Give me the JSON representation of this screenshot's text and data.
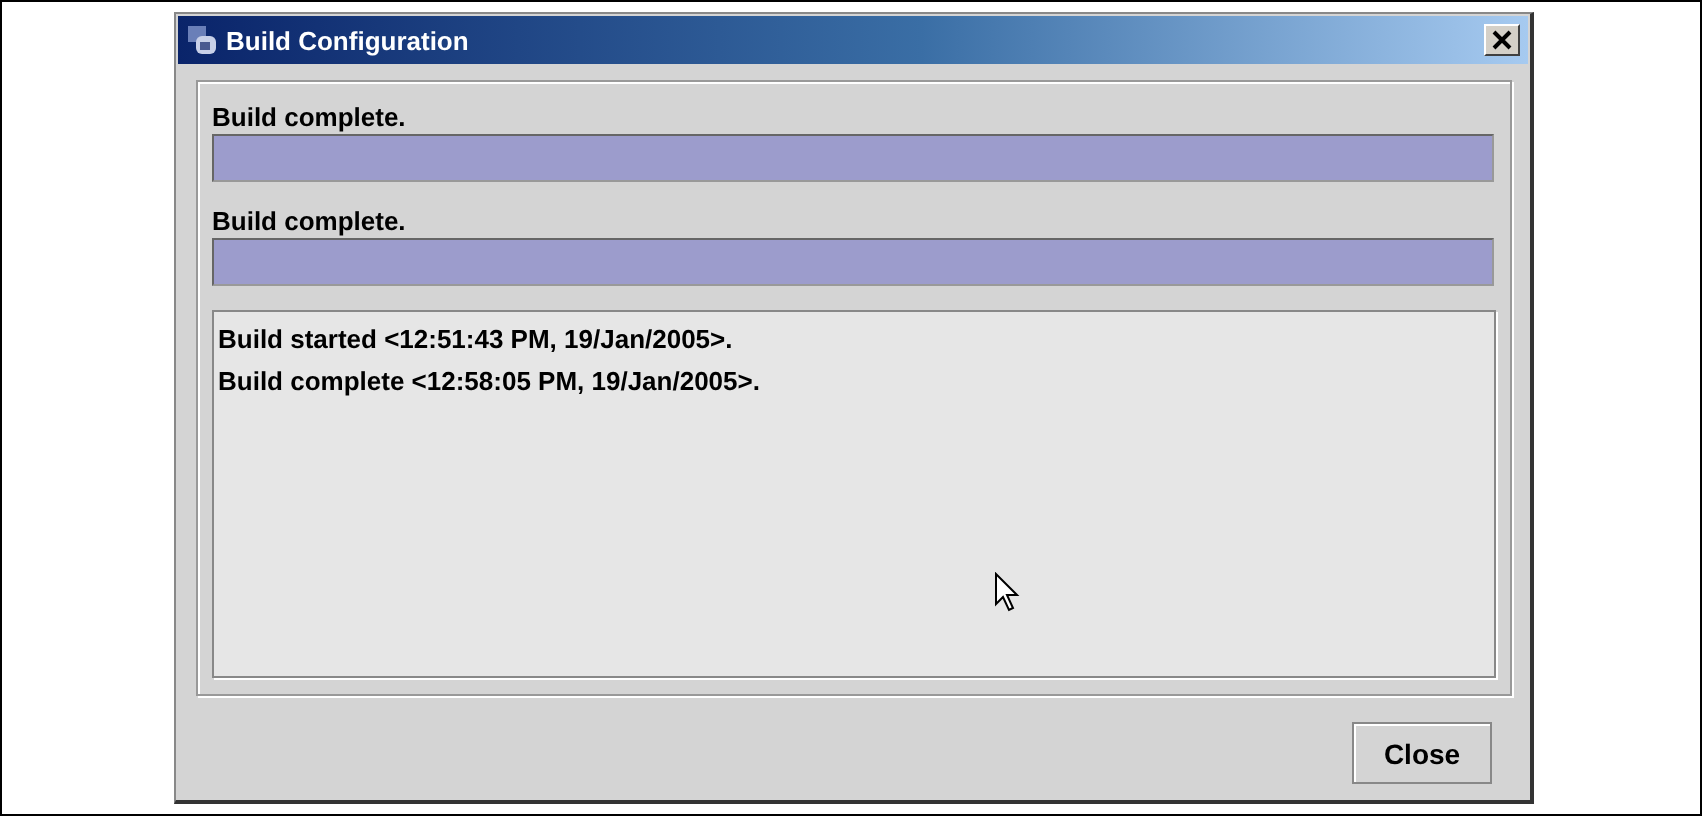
{
  "window": {
    "title": "Build Configuration"
  },
  "progress": [
    {
      "label": "Build complete.",
      "level": 1
    },
    {
      "label": "Build complete.",
      "level": 1
    }
  ],
  "log": [
    "Build started <12:51:43 PM, 19/Jan/2005>.",
    "Build complete <12:58:05 PM, 19/Jan/2005>."
  ],
  "buttons": [
    {
      "label": "Close"
    }
  ]
}
